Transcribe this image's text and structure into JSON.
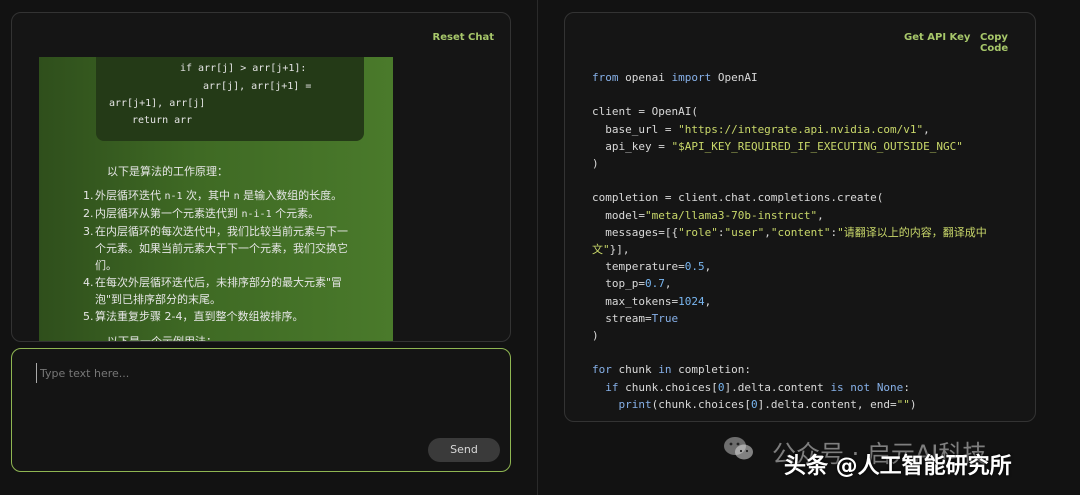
{
  "chat": {
    "reset_label": "Reset Chat",
    "code_lines": [
      "if arr[j] > arr[j+1]:",
      "arr[j], arr[j+1] =",
      "arr[j+1], arr[j]",
      "return arr"
    ],
    "intro": "以下是算法的工作原理：",
    "steps": [
      {
        "num": "1.",
        "parts": [
          "外层循环迭代 ",
          "n-1",
          " 次，其中 ",
          "n",
          " 是输入数组的长度。"
        ]
      },
      {
        "num": "2.",
        "parts": [
          "内层循环从第一个元素迭代到 ",
          "n-i-1",
          " 个元素。"
        ]
      },
      {
        "num": "3.",
        "line1": "在内层循环的每次迭代中，我们比较当前元素与下一",
        "line2": "个元素。如果当前元素大于下一个元素，我们交换它",
        "line3": "们。"
      },
      {
        "num": "4.",
        "line1": "在每次外层循环迭代后，未排序部分的最大元素\"冒",
        "line2": "泡\"到已排序部分的末尾。"
      },
      {
        "num": "5.",
        "parts": [
          "算法重复步骤 2-4，直到整个数组被排序。"
        ]
      }
    ],
    "example_intro": "以下是一个示例用法："
  },
  "input": {
    "placeholder": "Type text here...",
    "send_label": "Send"
  },
  "code_panel": {
    "get_api_key_label": "Get API Key",
    "copy_code_label": "Copy Code",
    "lines": {
      "l1a": "from",
      "l1b": " openai ",
      "l1c": "import",
      "l1d": " OpenAI",
      "l3": "client = OpenAI(",
      "l4a": "  base_url = ",
      "l4b": "\"https://integrate.api.nvidia.com/v1\"",
      "l4c": ",",
      "l5a": "  api_key = ",
      "l5b": "\"$API_KEY_REQUIRED_IF_EXECUTING_OUTSIDE_NGC\"",
      "l6": ")",
      "l8": "completion = client.chat.completions.create(",
      "l9a": "  model=",
      "l9b": "\"meta/llama3-70b-instruct\"",
      "l9c": ",",
      "l10a": "  messages=[{",
      "l10b": "\"role\"",
      "l10c": ":",
      "l10d": "\"user\"",
      "l10e": ",",
      "l10f": "\"content\"",
      "l10g": ":",
      "l10h": "\"请翻译以上的内容，翻译成中",
      "l11a": "文\"",
      "l11b": "}],",
      "l12a": "  temperature=",
      "l12b": "0.5",
      "l12c": ",",
      "l13a": "  top_p=",
      "l13b": "0.7",
      "l13c": ",",
      "l14a": "  max_tokens=",
      "l14b": "1024",
      "l14c": ",",
      "l15a": "  stream=",
      "l15b": "True",
      "l16": ")",
      "l18a": "for",
      "l18b": " chunk ",
      "l18c": "in",
      "l18d": " completion:",
      "l19a": "  ",
      "l19b": "if",
      "l19c": " chunk.choices[",
      "l19d": "0",
      "l19e": "].delta.content ",
      "l19f": "is not",
      "l19g": " ",
      "l19h": "None",
      "l19i": ":",
      "l20a": "    ",
      "l20b": "print",
      "l20c": "(chunk.choices[",
      "l20d": "0",
      "l20e": "].delta.content, end=",
      "l20f": "\"\"",
      "l20g": ")"
    }
  },
  "watermark": {
    "line1": "公众号 · 启元AI科技",
    "line2": "头条 @人工智能研究所"
  }
}
